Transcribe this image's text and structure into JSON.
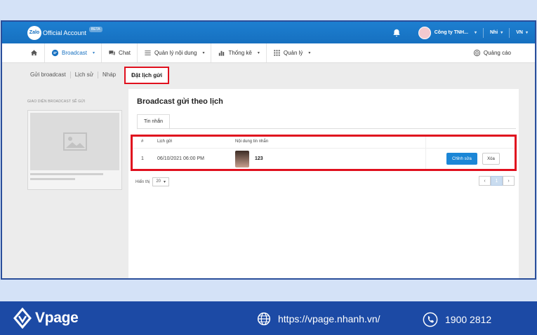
{
  "app": {
    "logo_text": "Zalo",
    "title": "Official Account",
    "badge": "BETA",
    "company": "Công ty TNH...",
    "user": "Nhi",
    "language": "VN"
  },
  "nav": {
    "items": [
      {
        "label": "Broadcast",
        "icon": "chat-bubble-icon"
      },
      {
        "label": "Chat",
        "icon": "messages-icon"
      },
      {
        "label": "Quản lý nội dung",
        "icon": "list-icon"
      },
      {
        "label": "Thống kê",
        "icon": "bar-chart-icon"
      },
      {
        "label": "Quản lý",
        "icon": "grid-icon"
      }
    ],
    "ads": "Quảng cáo"
  },
  "subtabs": [
    "Gửi broadcast",
    "Lịch sử",
    "Nháp"
  ],
  "active_subtab": "Đặt lịch gửi",
  "left_panel": {
    "title": "GIAO DIỆN BROADCAST SẼ GỬI"
  },
  "main": {
    "title": "Broadcast gửi theo lịch",
    "tab": "Tin nhắn",
    "columns": [
      "#",
      "Lịch gửi",
      "Nội dung tin nhắn"
    ],
    "rows": [
      {
        "index": "1",
        "schedule": "06/10/2021 06:00 PM",
        "content": "123",
        "edit": "Chỉnh sửa",
        "delete": "Xóa"
      }
    ],
    "page_size_label": "Hiển thị",
    "page_size": "20",
    "current_page": "1"
  },
  "footer": {
    "brand": "Vpage",
    "website": "https://vpage.nhanh.vn/",
    "phone": "1900 2812",
    "color": "#1c4aa5"
  }
}
